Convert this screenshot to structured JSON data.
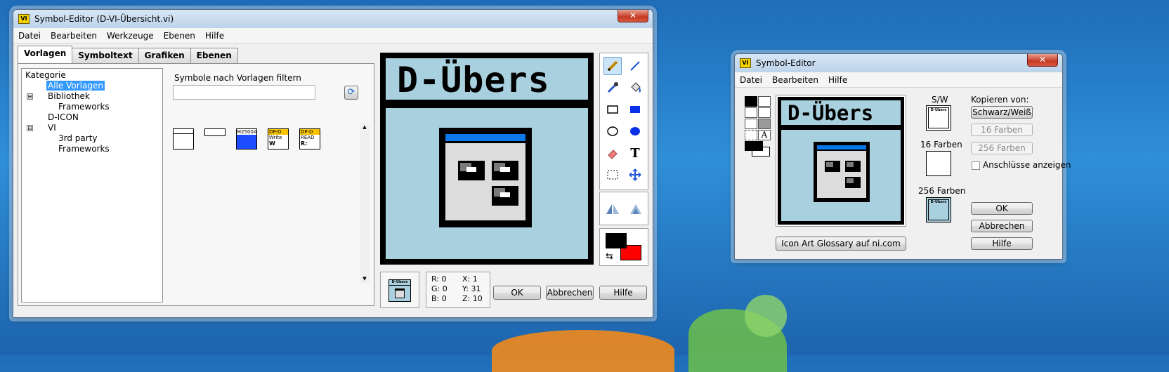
{
  "main": {
    "title": "Symbol-Editor (D-VI-Übersicht.vi)",
    "close": "✕",
    "title_badge": "VI",
    "menu": [
      "Datei",
      "Bearbeiten",
      "Werkzeuge",
      "Ebenen",
      "Hilfe"
    ],
    "tabs": [
      "Vorlagen",
      "Symboltext",
      "Grafiken",
      "Ebenen"
    ],
    "tree": {
      "header": "Kategorie",
      "items": [
        "Alle Vorlagen",
        "Bibliothek",
        "Frameworks",
        "D-ICON",
        "VI",
        "3rd party",
        "Frameworks"
      ],
      "toggles": [
        "⊟",
        "⊟"
      ]
    },
    "filter": {
      "label": "Symbole nach Vorlagen filtern",
      "value": "",
      "refresh": "⟳"
    },
    "templates": [
      {
        "label": ""
      },
      {
        "label": ""
      },
      {
        "label": "M2500A",
        "sub": ""
      },
      {
        "label": "DP-D",
        "sub": "Write",
        "foot": "W"
      },
      {
        "label": "DP-D",
        "sub": "READ",
        "foot": "R:"
      }
    ],
    "scroll": {
      "up": "▲",
      "down": "▼"
    },
    "icon_text": "D-Übers",
    "readout": {
      "R": "R: 0",
      "G": "G: 0",
      "B": "B: 0",
      "X": "X: 1",
      "Y": "Y: 31",
      "Z": "Z: 10"
    },
    "preview_text": "D-Übers",
    "buttons": {
      "ok": "OK",
      "cancel": "Abbrechen",
      "help": "Hilfe"
    },
    "tools": [
      "pencil-icon",
      "line-icon",
      "dropper-icon",
      "fill-icon",
      "rectangle-icon",
      "filled-rectangle-icon",
      "ellipse-icon",
      "filled-ellipse-icon",
      "eraser-icon",
      "text-icon",
      "select-icon",
      "move-icon"
    ],
    "tool_text": "T",
    "flip_tools": [
      "flip-horizontal-icon",
      "flip-vertical-icon"
    ],
    "colors": {
      "foreground": "#000000",
      "background": "#ff0000",
      "swap": "⇆"
    }
  },
  "second": {
    "title": "Symbol-Editor",
    "close": "✕",
    "title_badge": "VI",
    "menu": [
      "Datei",
      "Bearbeiten",
      "Hilfe"
    ],
    "icon_text": "D-Übers",
    "tool_text": "A",
    "sw_label": "S/W",
    "f16_label": "16 Farben",
    "f256_label": "256 Farben",
    "copy_label": "Kopieren von:",
    "copy_buttons": [
      "Schwarz/Weiß",
      "16 Farben",
      "256 Farben"
    ],
    "checkbox": {
      "label": "Anschlüsse anzeigen",
      "checked": false
    },
    "buttons": {
      "ok": "OK",
      "cancel": "Abbrechen",
      "help": "Hilfe"
    },
    "glossary": "Icon Art Glossary auf ni.com",
    "thumb_text": "D-Übers"
  }
}
